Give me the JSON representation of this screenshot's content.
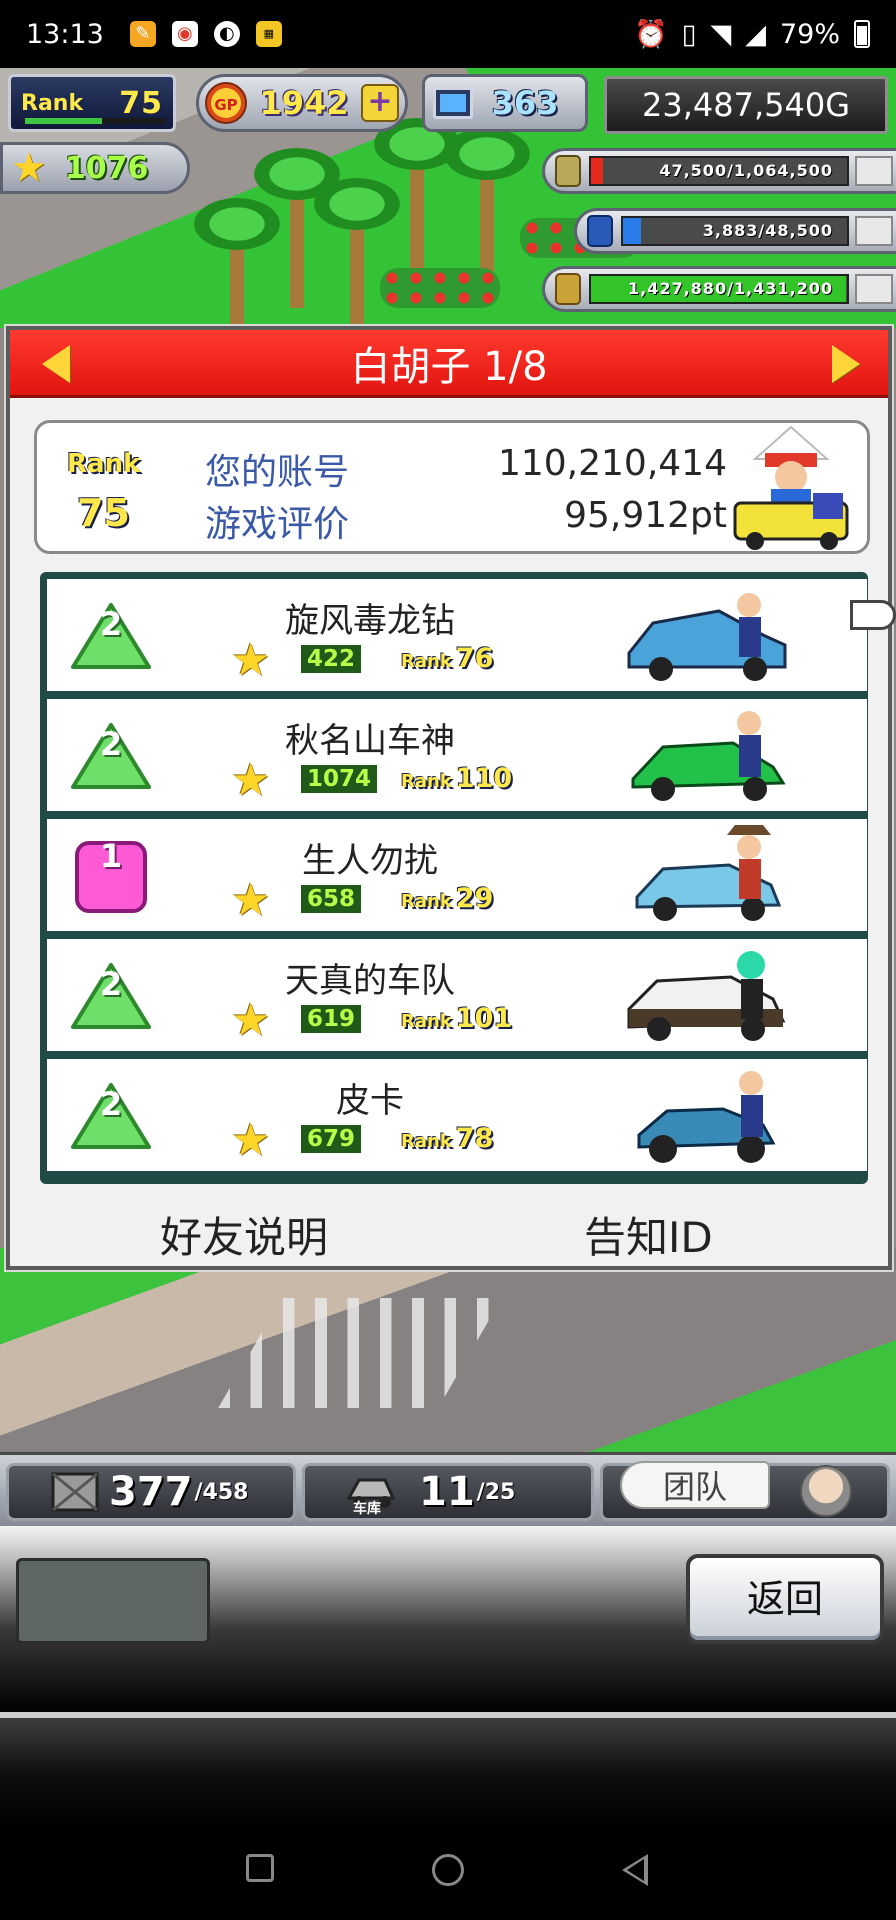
{
  "status_bar": {
    "time": "13:13",
    "battery": "79%"
  },
  "hud": {
    "rank_label": "Rank",
    "rank_value": "75",
    "gp_label": "GP",
    "gp_value": "1942",
    "gp_plus": "+",
    "pc_value": "363",
    "money": "23,487,540G",
    "stars": "1076",
    "resources": [
      {
        "name": "money-stack",
        "text": "47,500/1,064,500",
        "fill_fraction": 0.045,
        "color": "#e42b1d"
      },
      {
        "name": "fuel",
        "text": "3,883/48,500",
        "fill_fraction": 0.08,
        "color": "#2a7de8"
      },
      {
        "name": "research-leaf",
        "text": "1,427,880/1,431,200",
        "fill_fraction": 0.998,
        "color": "#33c42a"
      }
    ]
  },
  "dialog": {
    "title": "白胡子 1/8",
    "account": {
      "rank_label": "Rank",
      "rank_value": "75",
      "account_label": "您的账号",
      "account_value": "110,210,414",
      "rating_label": "游戏评价",
      "rating_value": "95,912pt"
    },
    "friends": [
      {
        "badge": "2",
        "badge_type": "green",
        "name": "旋风毒龙钻",
        "stars": "422",
        "rank_label": "Rank",
        "rank": "76",
        "car_color": "#4aa3d9"
      },
      {
        "badge": "2",
        "badge_type": "green",
        "name": "秋名山车神",
        "stars": "1074",
        "rank_label": "Rank",
        "rank": "110",
        "car_color": "#22c24a"
      },
      {
        "badge": "1",
        "badge_type": "pink",
        "name": "生人勿扰",
        "stars": "658",
        "rank_label": "Rank",
        "rank": "29",
        "car_color": "#7ac8e8"
      },
      {
        "badge": "2",
        "badge_type": "green",
        "name": "天真的车队",
        "stars": "619",
        "rank_label": "Rank",
        "rank": "101",
        "car_color": "#f2f2f2"
      },
      {
        "badge": "2",
        "badge_type": "green",
        "name": "皮卡",
        "stars": "679",
        "rank_label": "Rank",
        "rank": "78",
        "car_color": "#3a8ab8"
      }
    ],
    "footer": {
      "friend_info": "好友说明",
      "notify_id": "告知ID"
    }
  },
  "bottom_hud": {
    "parts_value": "377",
    "parts_max": "/458",
    "garage_label": "车库",
    "garage_value": "11",
    "garage_max": "/25",
    "team_label": "团队"
  },
  "actions": {
    "back": "返回"
  },
  "colors": {
    "header_red": "#e1140f",
    "list_border": "#1f4a45",
    "label_blue": "#3a5aa8"
  }
}
